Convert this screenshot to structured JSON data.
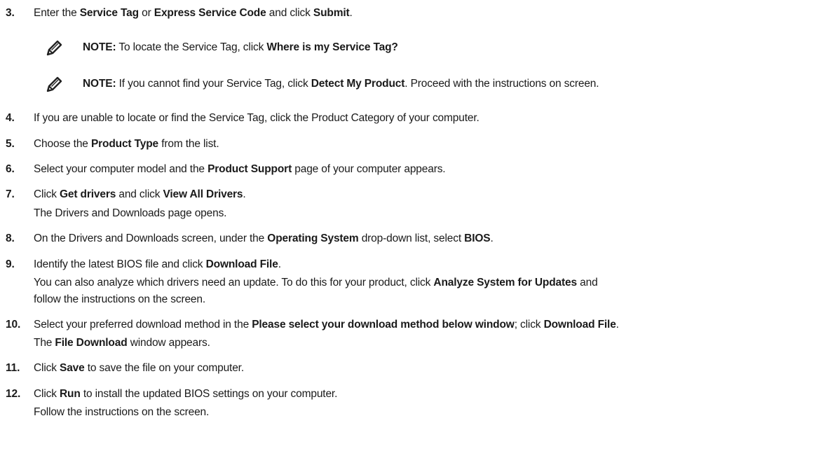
{
  "steps": {
    "s3": {
      "num": "3.",
      "t1": "Enter the ",
      "b1": "Service Tag",
      "t2": " or ",
      "b2": "Express Service Code",
      "t3": " and click ",
      "b3": "Submit",
      "t4": "."
    },
    "note1": {
      "label": "NOTE:",
      "t1": " To locate the Service Tag, click ",
      "b1": "Where is my Service Tag?"
    },
    "note2": {
      "label": "NOTE:",
      "t1": " If you cannot find your Service Tag, click ",
      "b1": "Detect My Product",
      "t2": ". Proceed with the instructions on screen."
    },
    "s4": {
      "num": "4.",
      "t1": "If you are unable to locate or find the Service Tag, click the Product Category of your computer."
    },
    "s5": {
      "num": "5.",
      "t1": "Choose the ",
      "b1": "Product Type",
      "t2": " from the list."
    },
    "s6": {
      "num": "6.",
      "t1": "Select your computer model and the ",
      "b1": "Product Support",
      "t2": " page of your computer appears."
    },
    "s7": {
      "num": "7.",
      "t1": "Click ",
      "b1": "Get drivers",
      "t2": " and click ",
      "b2": "View All Drivers",
      "t3": ".",
      "c1": "The Drivers and Downloads page opens."
    },
    "s8": {
      "num": "8.",
      "t1": "On the Drivers and Downloads screen, under the ",
      "b1": "Operating System",
      "t2": " drop-down list, select ",
      "b2": "BIOS",
      "t3": "."
    },
    "s9": {
      "num": "9.",
      "t1": "Identify the latest BIOS file and click ",
      "b1": "Download File",
      "t2": ".",
      "c1": "You can also analyze which drivers need an update. To do this for your product, click ",
      "cb1": "Analyze System for Updates",
      "c2": " and",
      "c3": "follow the instructions on the screen."
    },
    "s10": {
      "num": "10.",
      "t1": "Select your preferred download method in the ",
      "b1": "Please select your download method below window",
      "t2": "; click ",
      "b2": "Download File",
      "t3": ".",
      "c1": "The ",
      "cb1": "File Download",
      "c2": " window appears."
    },
    "s11": {
      "num": "11.",
      "t1": "Click ",
      "b1": "Save",
      "t2": " to save the file on your computer."
    },
    "s12": {
      "num": "12.",
      "t1": "Click ",
      "b1": "Run",
      "t2": " to install the updated BIOS settings on your computer.",
      "c1": "Follow the instructions on the screen."
    }
  },
  "icons": {
    "note": "pencil-note-icon"
  }
}
